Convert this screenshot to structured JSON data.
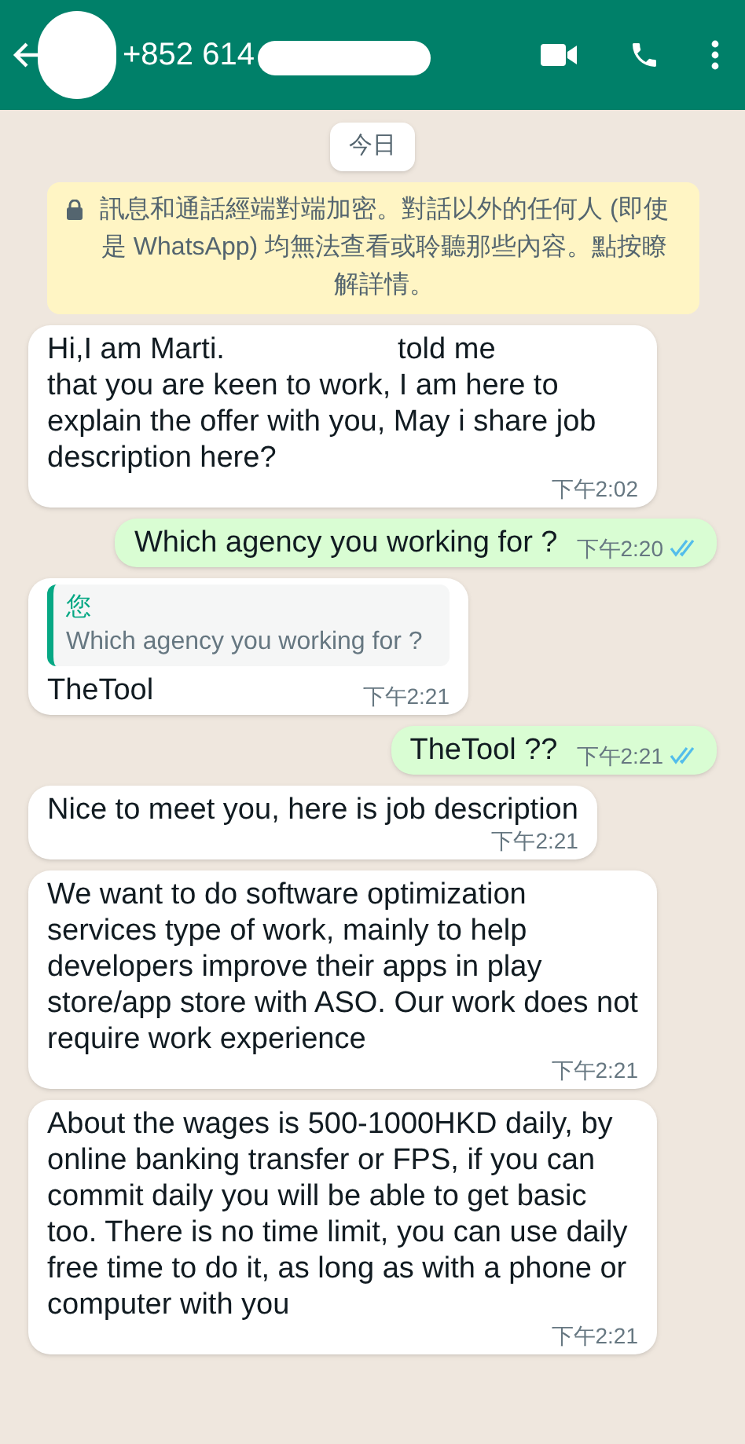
{
  "header": {
    "contact": "+852 614",
    "redacted": true
  },
  "date_chip": "今日",
  "encryption_notice": "訊息和通話經端對端加密。對話以外的任何人 (即使是 WhatsApp) 均無法查看或聆聽那些內容。點按瞭解詳情。",
  "messages": [
    {
      "kind": "incoming",
      "text_before_redaction": "Hi,I am Marti.",
      "text_after_redaction": "told me",
      "text": "that you are keen to work, I am here to explain the offer with you, May i share job description here?",
      "time": "下午2:02"
    },
    {
      "kind": "outgoing",
      "text": "Which agency you working for ?",
      "time": "下午2:20",
      "read": true
    },
    {
      "kind": "reply",
      "quote_author": "您",
      "quote_text": "Which agency you working for ?",
      "text": "TheTool",
      "time": "下午2:21"
    },
    {
      "kind": "outgoing",
      "text": "TheTool ??",
      "time": "下午2:21",
      "read": true
    },
    {
      "kind": "incoming",
      "text": "Nice to meet you, here is job description",
      "time": "下午2:21"
    },
    {
      "kind": "incoming",
      "text": "We want to do software optimization services type of work, mainly to help developers improve their apps in play store/app store with ASO. Our work does not require work experience",
      "time": "下午2:21"
    },
    {
      "kind": "incoming",
      "text": "About the wages is 500-1000HKD daily, by online banking transfer or FPS, if you can commit daily you will be able to get basic too. There is no time limit, you can use daily free time to do it, as long as with a phone or computer with you",
      "time": "下午2:21"
    }
  ]
}
